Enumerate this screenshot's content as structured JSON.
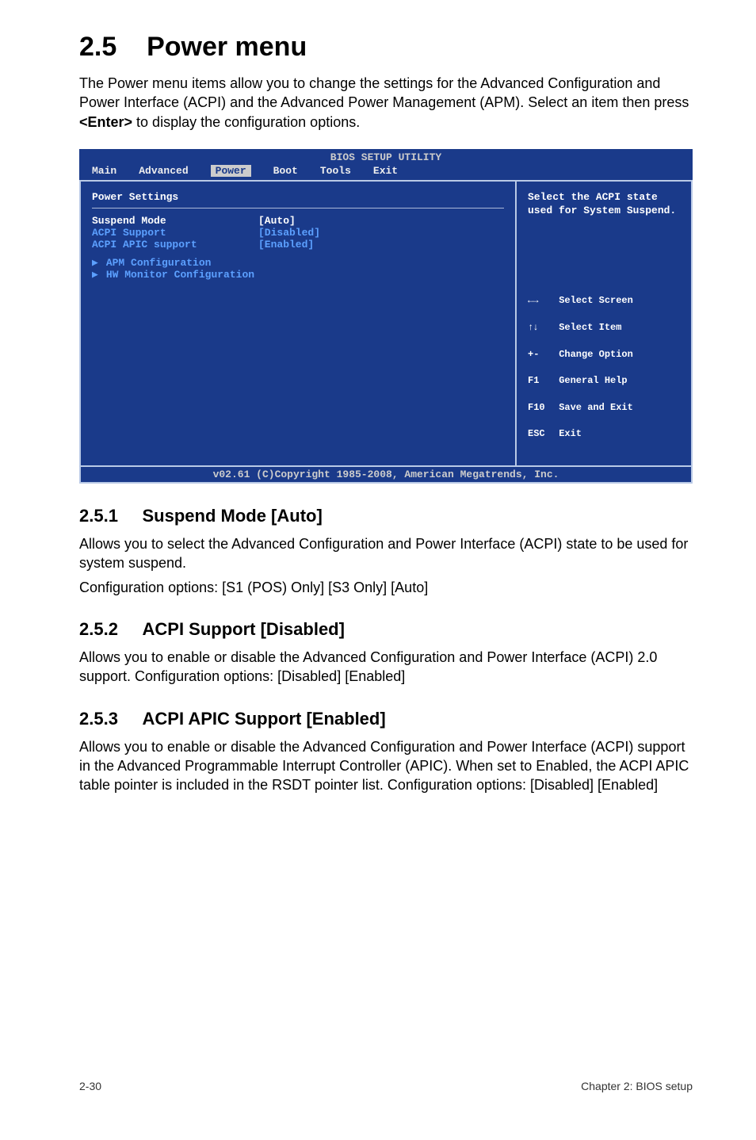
{
  "section": {
    "number": "2.5",
    "title": "Power menu"
  },
  "intro": "The Power menu items allow you to change the settings for the Advanced Configuration and Power Interface (ACPI) and the Advanced Power Management (APM). Select an item then press <Enter> to display the configuration options.",
  "bios": {
    "title": "BIOS SETUP UTILITY",
    "menu": {
      "items": [
        "Main",
        "Advanced",
        "Power",
        "Boot",
        "Tools",
        "Exit"
      ],
      "selected": "Power"
    },
    "panel_header": "Power Settings",
    "rows": [
      {
        "label": "Suspend Mode",
        "value": "[Auto]",
        "selected": true
      },
      {
        "label": "ACPI Support",
        "value": "[Disabled]",
        "selected": false
      },
      {
        "label": "ACPI APIC support",
        "value": "[Enabled]",
        "selected": false
      }
    ],
    "submenus": [
      "APM Configuration",
      "HW Monitor Configuration"
    ],
    "help_text": "Select the ACPI state used for System Suspend.",
    "help_keys": [
      {
        "key": "←→",
        "desc": "Select Screen"
      },
      {
        "key": "↑↓",
        "desc": "Select Item"
      },
      {
        "key": "+-",
        "desc": "Change Option"
      },
      {
        "key": "F1",
        "desc": "General Help"
      },
      {
        "key": "F10",
        "desc": "Save and Exit"
      },
      {
        "key": "ESC",
        "desc": "Exit"
      }
    ],
    "footer": "v02.61 (C)Copyright 1985-2008, American Megatrends, Inc."
  },
  "subsections": [
    {
      "num": "2.5.1",
      "title": "Suspend Mode [Auto]",
      "paras": [
        "Allows you to select the Advanced Configuration and Power Interface (ACPI) state to be used for system suspend.",
        "Configuration options: [S1 (POS) Only] [S3 Only] [Auto]"
      ]
    },
    {
      "num": "2.5.2",
      "title": "ACPI Support [Disabled]",
      "paras": [
        "Allows you to enable or disable the Advanced Configuration and Power Interface (ACPI) 2.0 support. Configuration options: [Disabled] [Enabled]"
      ]
    },
    {
      "num": "2.5.3",
      "title": "ACPI APIC Support [Enabled]",
      "paras": [
        "Allows you to enable or disable the Advanced Configuration and Power Interface (ACPI) support in the Advanced Programmable Interrupt Controller (APIC). When set to Enabled, the ACPI APIC table pointer is included in the RSDT pointer list. Configuration options: [Disabled] [Enabled]"
      ]
    }
  ],
  "footer": {
    "left": "2-30",
    "right": "Chapter 2: BIOS setup"
  }
}
